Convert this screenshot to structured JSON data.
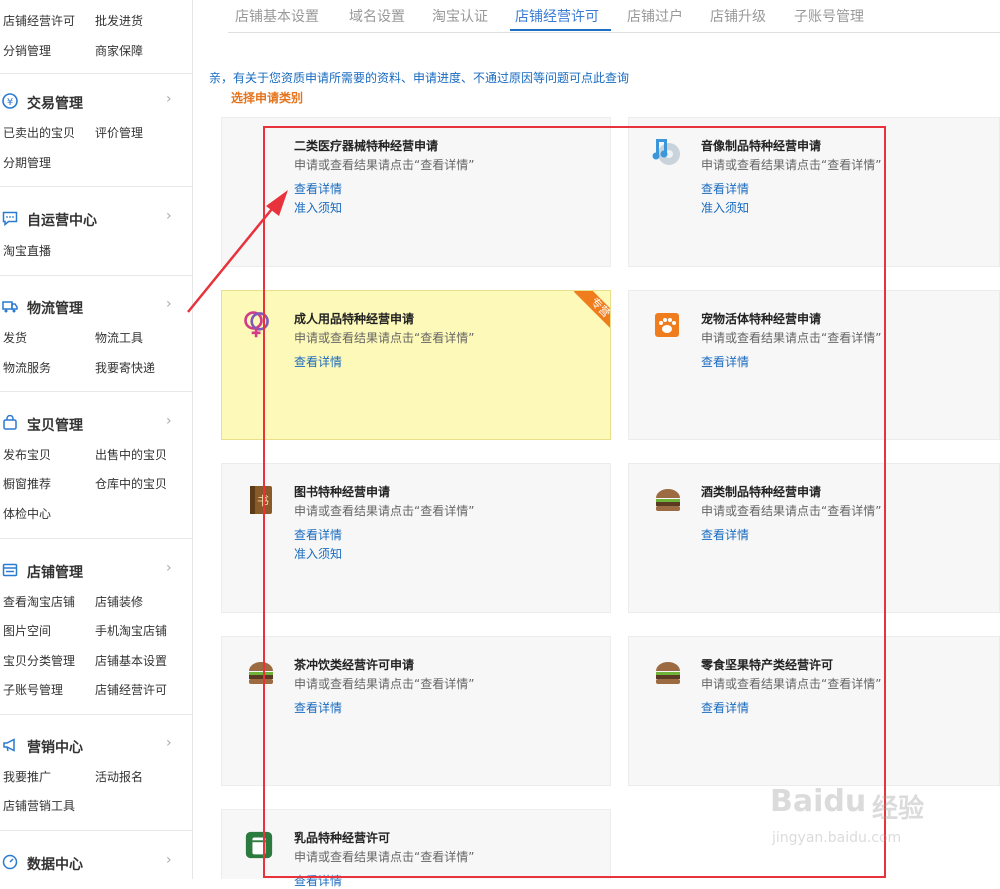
{
  "sidebar": {
    "top_links": [
      "店铺经营许可",
      "批发进货",
      "分销管理",
      "商家保障"
    ],
    "groups": [
      {
        "title": "交易管理",
        "icon": "currency-circle-icon",
        "links": [
          "已卖出的宝贝",
          "评价管理",
          "分期管理"
        ]
      },
      {
        "title": "自运营中心",
        "icon": "chat-bubble-icon",
        "links": [
          "淘宝直播"
        ]
      },
      {
        "title": "物流管理",
        "icon": "truck-icon",
        "links": [
          "发货",
          "物流工具",
          "物流服务",
          "我要寄快递"
        ]
      },
      {
        "title": "宝贝管理",
        "icon": "bag-icon",
        "links": [
          "发布宝贝",
          "出售中的宝贝",
          "橱窗推荐",
          "仓库中的宝贝",
          "体检中心"
        ]
      },
      {
        "title": "店铺管理",
        "icon": "shop-icon",
        "links": [
          "查看淘宝店铺",
          "店铺装修",
          "图片空间",
          "手机淘宝店铺",
          "宝贝分类管理",
          "店铺基本设置",
          "子账号管理",
          "店铺经营许可"
        ]
      },
      {
        "title": "营销中心",
        "icon": "megaphone-icon",
        "links": [
          "我要推广",
          "活动报名",
          "店铺营销工具"
        ]
      },
      {
        "title": "数据中心",
        "icon": "gauge-icon",
        "links": []
      }
    ],
    "chevron": "›"
  },
  "tabs": [
    "店铺基本设置",
    "域名设置",
    "淘宝认证",
    "店铺经营许可",
    "店铺过户",
    "店铺升级",
    "子账号管理"
  ],
  "active_tab": "店铺经营许可",
  "notice": "亲，有关于您资质申请所需要的资料、申请进度、不通过原因等问题可点此查询",
  "select_type_label": "选择申请类别",
  "cards": [
    {
      "title": "二类医疗器械特种经营申请",
      "desc": "申请或查看结果请点击“查看详情”",
      "link1": "查看详情",
      "link2": "准入须知",
      "icon": "medical-icon"
    },
    {
      "title": "音像制品特种经营申请",
      "desc": "申请或查看结果请点击“查看详情”",
      "link1": "查看详情",
      "link2": "准入须知",
      "icon": "music-disc-icon"
    },
    {
      "title": "成人用品特种经营申请",
      "desc": "申请或查看结果请点击“查看详情”",
      "link1": "查看详情",
      "link2": "",
      "icon": "gender-icon",
      "ribbon": "专营"
    },
    {
      "title": "宠物活体特种经营申请",
      "desc": "申请或查看结果请点击“查看详情”",
      "link1": "查看详情",
      "link2": "",
      "icon": "paw-icon"
    },
    {
      "title": "图书特种经营申请",
      "desc": "申请或查看结果请点击“查看详情”",
      "link1": "查看详情",
      "link2": "准入须知",
      "icon": "book-icon"
    },
    {
      "title": "酒类制品特种经营申请",
      "desc": "申请或查看结果请点击“查看详情”",
      "link1": "查看详情",
      "link2": "",
      "icon": "burger-icon"
    },
    {
      "title": "茶冲饮类经营许可申请",
      "desc": "申请或查看结果请点击“查看详情”",
      "link1": "查看详情",
      "link2": "",
      "icon": "burger-icon"
    },
    {
      "title": "零食坚果特产类经营许可",
      "desc": "申请或查看结果请点击“查看详情”",
      "link1": "查看详情",
      "link2": "",
      "icon": "burger-icon"
    },
    {
      "title": "乳品特种经营许可",
      "desc": "申请或查看结果请点击“查看详情”",
      "link1": "查看详情",
      "link2": "",
      "icon": "milk-icon"
    }
  ],
  "watermark": {
    "brand": "Baidu",
    "jingyan": "经验",
    "url": "jingyan.baidu.com"
  },
  "colors": {
    "link": "#1a6bbf",
    "accent": "#e4741d",
    "highlight": "#fdf9b8",
    "annotation": "#e8333c",
    "active_tab": "#1f6fc4"
  }
}
